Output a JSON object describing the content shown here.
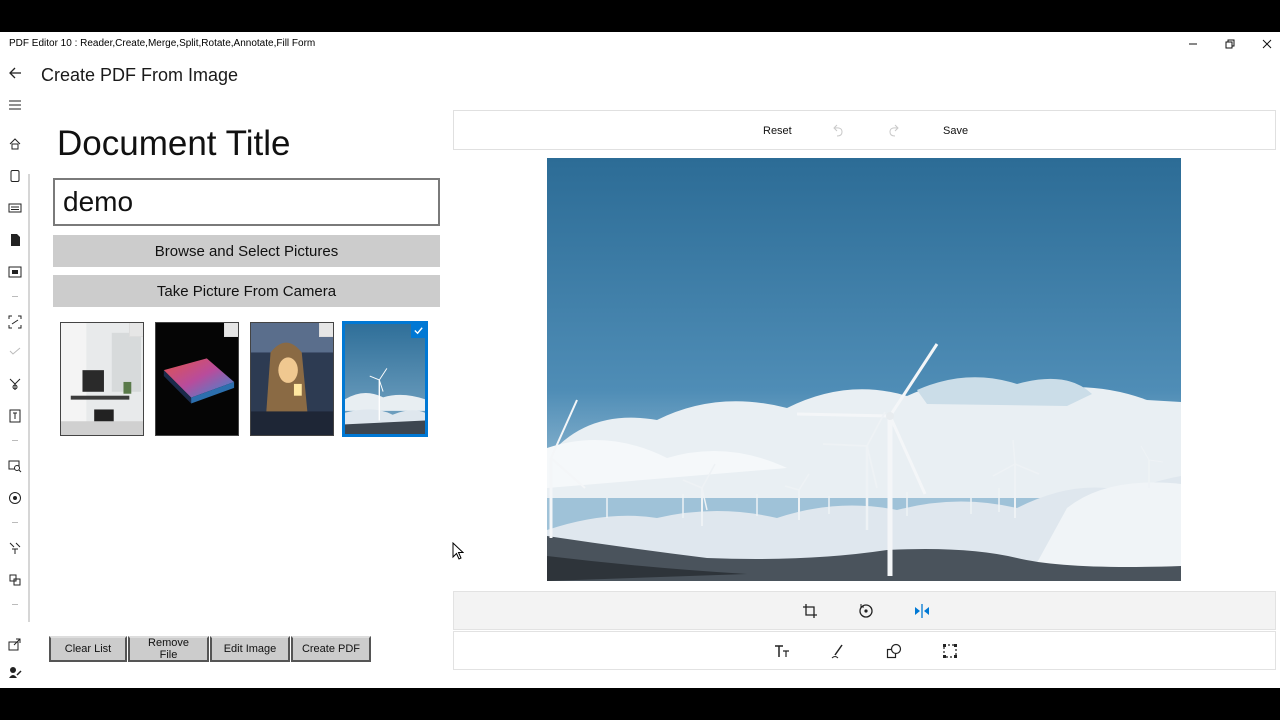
{
  "window": {
    "title": "PDF Editor 10 : Reader,Create,Merge,Split,Rotate,Annotate,Fill Form",
    "controls": [
      "minimize-icon",
      "restore-icon",
      "close-icon"
    ]
  },
  "nav": {
    "items": [
      "back-arrow-icon",
      "hamburger-menu-icon",
      "home-icon",
      "tablet-icon",
      "news-icon",
      "document-icon",
      "image-pdf-icon",
      "scan-icon",
      "sign-icon",
      "merge-icon",
      "text-fit-icon",
      "image-search-icon",
      "compass-icon",
      "pen-tools-icon",
      "stamp-icon",
      "share-icon",
      "user-edit-icon"
    ]
  },
  "page": {
    "title": "Create PDF From Image"
  },
  "form": {
    "doc_title_label": "Document Title",
    "doc_title_value": "demo",
    "browse_label": "Browse and Select Pictures",
    "camera_label": "Take Picture From Camera"
  },
  "thumbnails": [
    {
      "name": "office-desk-photo",
      "checked": false
    },
    {
      "name": "laptop-neon-photo",
      "checked": false
    },
    {
      "name": "woman-phone-photo",
      "checked": false
    },
    {
      "name": "wind-turbines-photo",
      "checked": true
    }
  ],
  "actions": {
    "clear": "Clear List",
    "remove": "Remove File",
    "edit": "Edit Image",
    "create": "Create PDF"
  },
  "editor": {
    "reset_label": "Reset",
    "save_label": "Save",
    "undo_icon": "undo-icon",
    "redo_icon": "redo-icon",
    "tools_row1": [
      "crop-icon",
      "rotate-icon",
      "flip-icon"
    ],
    "tools_row2": [
      "text-icon",
      "pen-icon",
      "shapes-icon",
      "selection-icon"
    ],
    "accent": "#0078d4"
  }
}
